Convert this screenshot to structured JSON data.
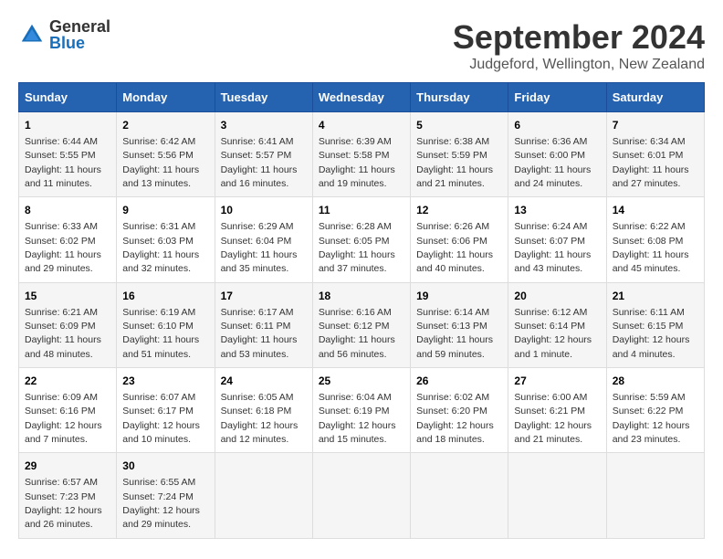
{
  "logo": {
    "general": "General",
    "blue": "Blue"
  },
  "title": "September 2024",
  "location": "Judgeford, Wellington, New Zealand",
  "days_header": [
    "Sunday",
    "Monday",
    "Tuesday",
    "Wednesday",
    "Thursday",
    "Friday",
    "Saturday"
  ],
  "weeks": [
    [
      {
        "day": "1",
        "sunrise": "6:44 AM",
        "sunset": "5:55 PM",
        "daylight": "11 hours and 11 minutes."
      },
      {
        "day": "2",
        "sunrise": "6:42 AM",
        "sunset": "5:56 PM",
        "daylight": "11 hours and 13 minutes."
      },
      {
        "day": "3",
        "sunrise": "6:41 AM",
        "sunset": "5:57 PM",
        "daylight": "11 hours and 16 minutes."
      },
      {
        "day": "4",
        "sunrise": "6:39 AM",
        "sunset": "5:58 PM",
        "daylight": "11 hours and 19 minutes."
      },
      {
        "day": "5",
        "sunrise": "6:38 AM",
        "sunset": "5:59 PM",
        "daylight": "11 hours and 21 minutes."
      },
      {
        "day": "6",
        "sunrise": "6:36 AM",
        "sunset": "6:00 PM",
        "daylight": "11 hours and 24 minutes."
      },
      {
        "day": "7",
        "sunrise": "6:34 AM",
        "sunset": "6:01 PM",
        "daylight": "11 hours and 27 minutes."
      }
    ],
    [
      {
        "day": "8",
        "sunrise": "6:33 AM",
        "sunset": "6:02 PM",
        "daylight": "11 hours and 29 minutes."
      },
      {
        "day": "9",
        "sunrise": "6:31 AM",
        "sunset": "6:03 PM",
        "daylight": "11 hours and 32 minutes."
      },
      {
        "day": "10",
        "sunrise": "6:29 AM",
        "sunset": "6:04 PM",
        "daylight": "11 hours and 35 minutes."
      },
      {
        "day": "11",
        "sunrise": "6:28 AM",
        "sunset": "6:05 PM",
        "daylight": "11 hours and 37 minutes."
      },
      {
        "day": "12",
        "sunrise": "6:26 AM",
        "sunset": "6:06 PM",
        "daylight": "11 hours and 40 minutes."
      },
      {
        "day": "13",
        "sunrise": "6:24 AM",
        "sunset": "6:07 PM",
        "daylight": "11 hours and 43 minutes."
      },
      {
        "day": "14",
        "sunrise": "6:22 AM",
        "sunset": "6:08 PM",
        "daylight": "11 hours and 45 minutes."
      }
    ],
    [
      {
        "day": "15",
        "sunrise": "6:21 AM",
        "sunset": "6:09 PM",
        "daylight": "11 hours and 48 minutes."
      },
      {
        "day": "16",
        "sunrise": "6:19 AM",
        "sunset": "6:10 PM",
        "daylight": "11 hours and 51 minutes."
      },
      {
        "day": "17",
        "sunrise": "6:17 AM",
        "sunset": "6:11 PM",
        "daylight": "11 hours and 53 minutes."
      },
      {
        "day": "18",
        "sunrise": "6:16 AM",
        "sunset": "6:12 PM",
        "daylight": "11 hours and 56 minutes."
      },
      {
        "day": "19",
        "sunrise": "6:14 AM",
        "sunset": "6:13 PM",
        "daylight": "11 hours and 59 minutes."
      },
      {
        "day": "20",
        "sunrise": "6:12 AM",
        "sunset": "6:14 PM",
        "daylight": "12 hours and 1 minute."
      },
      {
        "day": "21",
        "sunrise": "6:11 AM",
        "sunset": "6:15 PM",
        "daylight": "12 hours and 4 minutes."
      }
    ],
    [
      {
        "day": "22",
        "sunrise": "6:09 AM",
        "sunset": "6:16 PM",
        "daylight": "12 hours and 7 minutes."
      },
      {
        "day": "23",
        "sunrise": "6:07 AM",
        "sunset": "6:17 PM",
        "daylight": "12 hours and 10 minutes."
      },
      {
        "day": "24",
        "sunrise": "6:05 AM",
        "sunset": "6:18 PM",
        "daylight": "12 hours and 12 minutes."
      },
      {
        "day": "25",
        "sunrise": "6:04 AM",
        "sunset": "6:19 PM",
        "daylight": "12 hours and 15 minutes."
      },
      {
        "day": "26",
        "sunrise": "6:02 AM",
        "sunset": "6:20 PM",
        "daylight": "12 hours and 18 minutes."
      },
      {
        "day": "27",
        "sunrise": "6:00 AM",
        "sunset": "6:21 PM",
        "daylight": "12 hours and 21 minutes."
      },
      {
        "day": "28",
        "sunrise": "5:59 AM",
        "sunset": "6:22 PM",
        "daylight": "12 hours and 23 minutes."
      }
    ],
    [
      {
        "day": "29",
        "sunrise": "6:57 AM",
        "sunset": "7:23 PM",
        "daylight": "12 hours and 26 minutes."
      },
      {
        "day": "30",
        "sunrise": "6:55 AM",
        "sunset": "7:24 PM",
        "daylight": "12 hours and 29 minutes."
      },
      null,
      null,
      null,
      null,
      null
    ]
  ]
}
